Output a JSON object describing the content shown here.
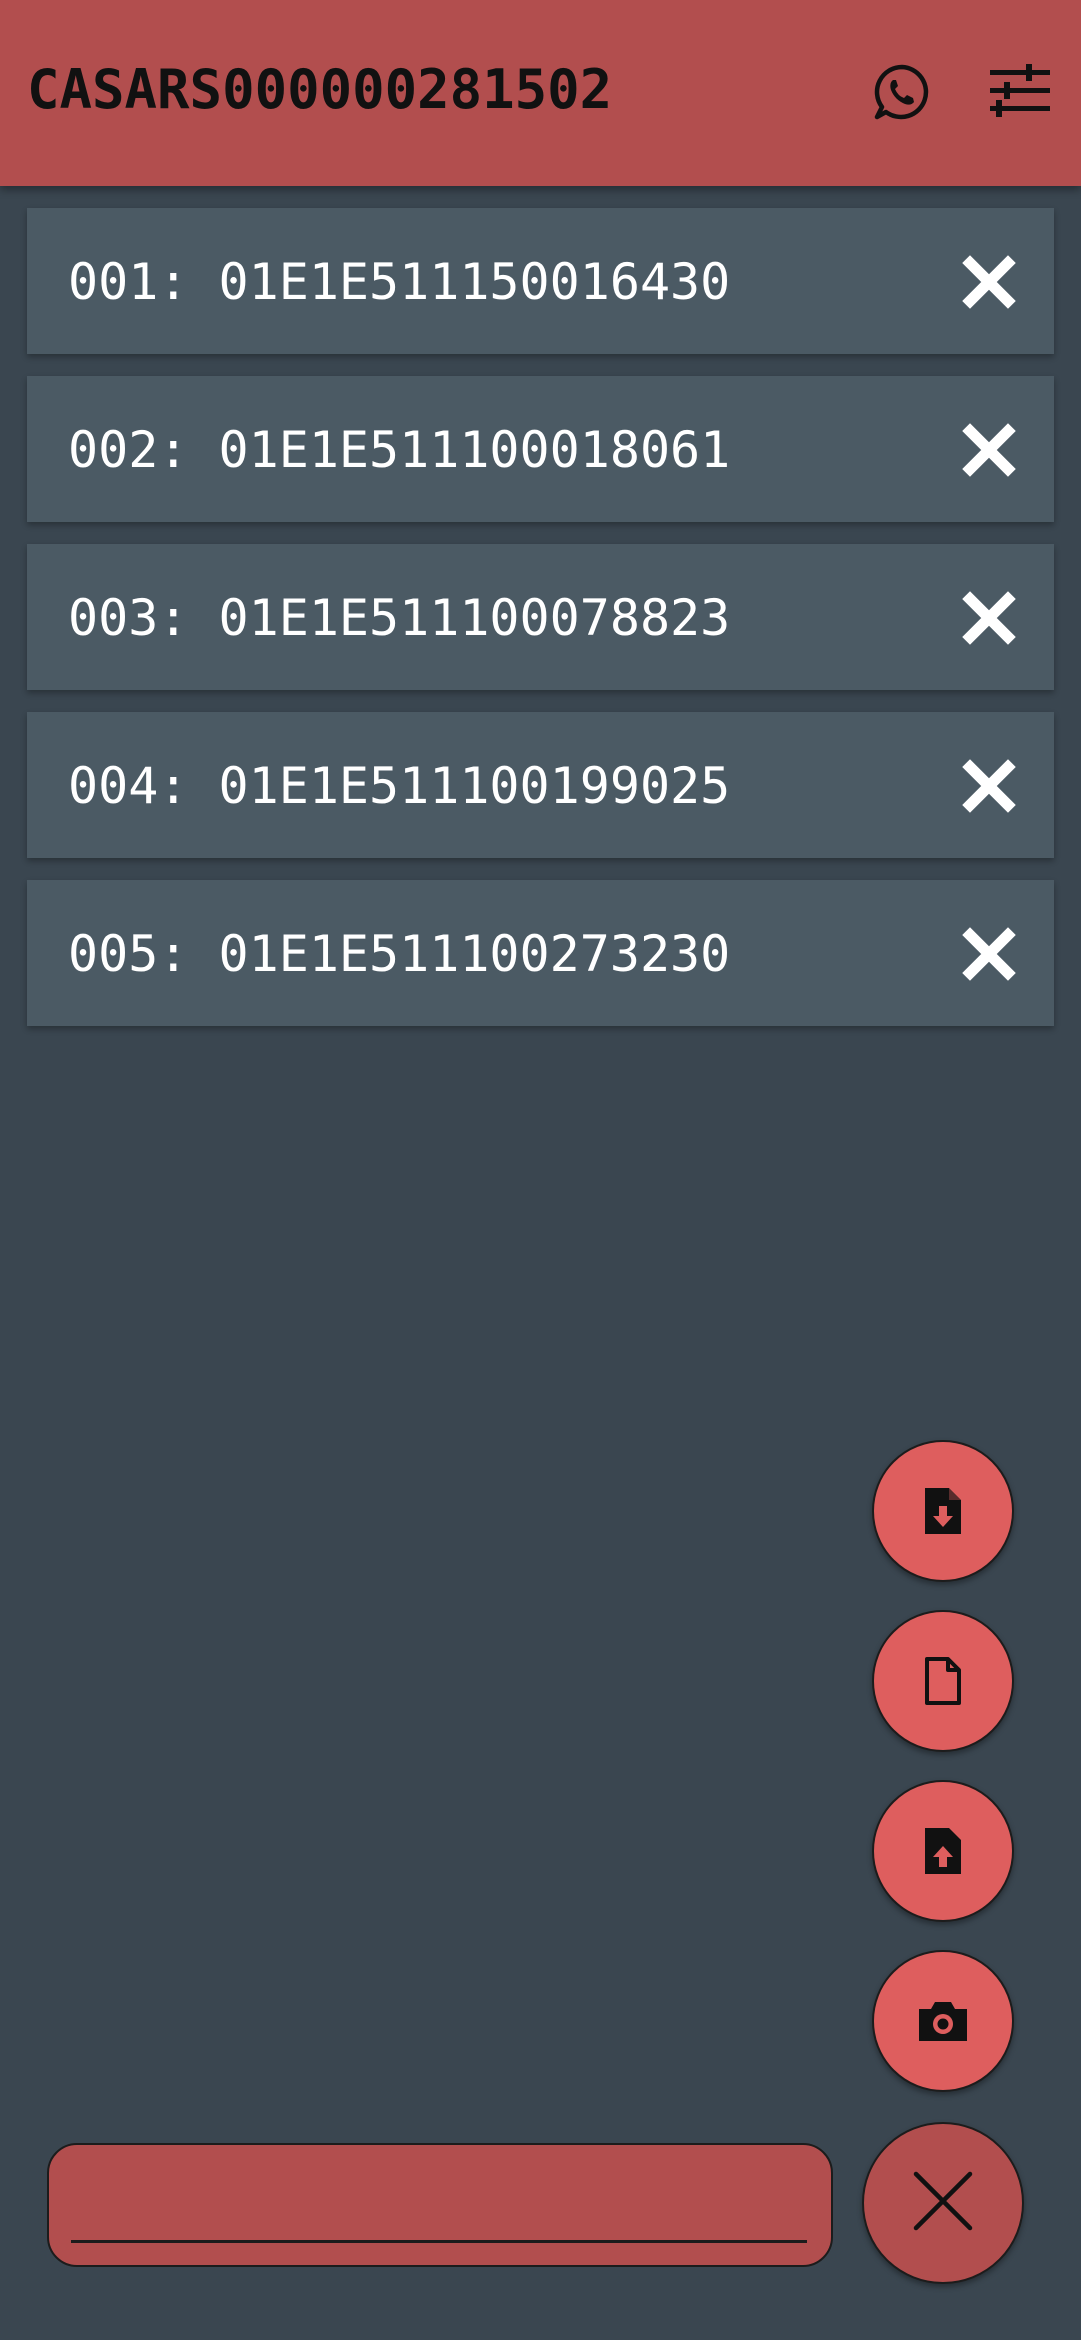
{
  "header": {
    "title": "CASARS000000281502",
    "whatsapp_icon": "whatsapp-icon",
    "settings_icon": "tune-sliders-icon"
  },
  "colors": {
    "header_bg": "#b24e4e",
    "page_bg": "#3a4650",
    "row_bg": "#4b5a64",
    "fab_bg": "#de5e5e"
  },
  "items": [
    {
      "text": "001: 01E1E511150016430",
      "remove_icon": "close-icon"
    },
    {
      "text": "002: 01E1E511100018061",
      "remove_icon": "close-icon"
    },
    {
      "text": "003: 01E1E511100078823",
      "remove_icon": "close-icon"
    },
    {
      "text": "004: 01E1E511100199025",
      "remove_icon": "close-icon"
    },
    {
      "text": "005: 01E1E511100273230",
      "remove_icon": "close-icon"
    }
  ],
  "fab_menu": {
    "download_icon": "file-download-icon",
    "file_icon": "file-icon",
    "upload_icon": "file-upload-icon",
    "camera_icon": "camera-icon",
    "close_icon": "close-icon"
  },
  "input": {
    "value": "",
    "placeholder": ""
  }
}
